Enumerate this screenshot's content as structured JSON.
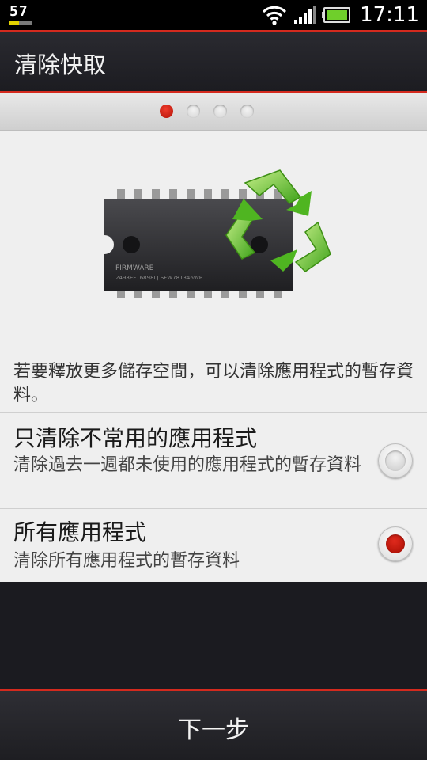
{
  "status_bar": {
    "left_badge": "57",
    "time": "17:11",
    "icons": [
      "wifi-icon",
      "signal-icon",
      "battery-icon"
    ]
  },
  "title_bar": {
    "title": "清除快取"
  },
  "pager": {
    "total_pages": 4,
    "current_page": 1
  },
  "illustration": {
    "chip_label": "FIRMWARE",
    "chip_code": "2498EF16898LJ SFW781346WP",
    "icon": "recycle-icon"
  },
  "description": "若要釋放更多儲存空間，可以清除應用程式的暫存資料。",
  "options": [
    {
      "title": "只清除不常用的應用程式",
      "subtitle": "清除過去一週都未使用的應用程式的暫存資料",
      "selected": false
    },
    {
      "title": "所有應用程式",
      "subtitle": "清除所有應用程式的暫存資料",
      "selected": true
    }
  ],
  "bottom_button": {
    "label": "下一步"
  },
  "colors": {
    "accent": "#d42a1e",
    "background_dark": "#1b1b20",
    "panel": "#efefef"
  }
}
